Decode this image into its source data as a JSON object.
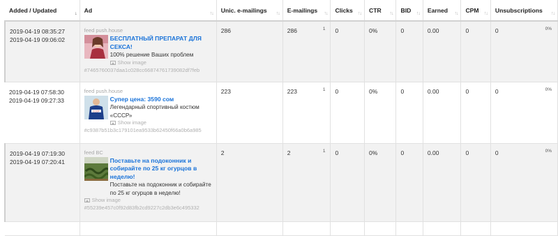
{
  "columns": {
    "added_updated": "Added / Updated",
    "ad": "Ad",
    "unic_emailings": "Unic. e-mailings",
    "emailings": "E-mailings",
    "clicks": "Clicks",
    "ctr": "CTR",
    "bid": "BID",
    "earned": "Earned",
    "cpm": "CPM",
    "unsubscriptions": "Unsubscriptions"
  },
  "rows": [
    {
      "added": "2019-04-19 08:35:27",
      "updated": "2019-04-19 09:06:02",
      "source": "feed push.house",
      "title": "БЕСПЛАТНЫЙ ПРЕПАРАТ ДЛЯ СЕКСА!",
      "desc": "100% решение Ваших проблем",
      "show_image": "Show image",
      "hash": "#7465760037daa1c028cc66874761739082df7feb",
      "unic": "286",
      "emailings": "286",
      "emailings_sup": "1",
      "clicks": "0",
      "ctr": "0%",
      "bid": "0",
      "earned": "0.00",
      "cpm": "0",
      "unsub": "0",
      "unsub_pct": "0%"
    },
    {
      "added": "2019-04-19 07:58:30",
      "updated": "2019-04-19 09:27:33",
      "source": "feed push.house",
      "title": "Супер цена: 3590 сом",
      "desc": "Легендарный спортивный костюм «СССР»",
      "show_image": "Show image",
      "hash": "#c9387b51b3c179101ea9533b62450f66a0b6a985",
      "unic": "223",
      "emailings": "223",
      "emailings_sup": "1",
      "clicks": "0",
      "ctr": "0%",
      "bid": "0",
      "earned": "0.00",
      "cpm": "0",
      "unsub": "0",
      "unsub_pct": "0%"
    },
    {
      "added": "2019-04-19 07:19:30",
      "updated": "2019-04-19 07:20:41",
      "source": "feed BC",
      "title": "Поставьте на подоконник и собирайте по 25 кг огурцов в неделю!",
      "desc": "Поставьте на подоконник и собирайте по 25 кг огурцов в неделю!",
      "show_image": "Show image",
      "hash": "#55239e457c0f92d83fb2cd9227c2db3e6c495332",
      "unic": "2",
      "emailings": "2",
      "emailings_sup": "1",
      "clicks": "0",
      "ctr": "0%",
      "bid": "0",
      "earned": "0.00",
      "cpm": "0",
      "unsub": "0",
      "unsub_pct": "0%"
    }
  ],
  "icons": {
    "sort": "sort-icon",
    "sort_active": "sort-down-icon",
    "show_image": "image-icon"
  },
  "colors": {
    "link": "#1a73d9",
    "muted": "#b0b0b0",
    "row_alt": "#f2f2f2"
  }
}
